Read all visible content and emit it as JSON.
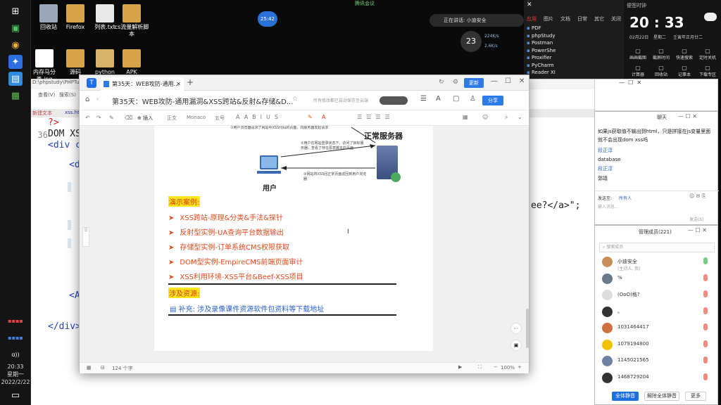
{
  "desktop": {
    "icons": [
      {
        "label": "回收站",
        "color": "#9aa6b8"
      },
      {
        "label": "Firefox",
        "color": "#d8a44a"
      },
      {
        "label": "列表.txt",
        "color": "#e8e8e8"
      },
      {
        "label": "cs流量解析脚本",
        "color": "#d8a44a"
      },
      {
        "label": "内存马分类.jpg",
        "color": "#ffffff"
      },
      {
        "label": "源码",
        "color": "#d8a44a"
      },
      {
        "label": "python",
        "color": "#d8b46a"
      },
      {
        "label": "APK",
        "color": "#d8a44a"
      }
    ],
    "meeting_label": "腾讯会议",
    "recording_time": "25:42",
    "speaking": "正在讲话: 小迪安全",
    "net_badge": "23",
    "net_up": "224K/s",
    "net_down": "2.6K/s"
  },
  "taskbar": {
    "time": "20:33",
    "weekday": "星期一",
    "date": "2022/2/22",
    "tray_text": "ɑ))"
  },
  "editor": {
    "path": "D:\\phpstudy\\PHPTutor",
    "menu_view": "查看(V)",
    "menu_search": "搜索(S)",
    "tabs": [
      "新建文本",
      "xss.html"
    ],
    "lines": [
      {
        "num": "",
        "text": "?>"
      },
      {
        "num": "36",
        "text": "DOM XSS"
      },
      {
        "num": "",
        "text": "<div c"
      },
      {
        "num": "",
        "text": "<d"
      },
      {
        "num": "",
        "text": "<A"
      },
      {
        "num": "",
        "text": "</div>"
      }
    ],
    "trailing_code": "ee?</a>\";"
  },
  "window": {
    "tab_title": "第35天：WEB攻防-通用...",
    "doc_title": "第35天：WEB攻防-通用漏洞&XSS跨站&反射&存储&D...",
    "save_hint": "所有修改都已自动保存至云端",
    "update_label": "更新",
    "share_label": "分享",
    "toolbar": [
      "插入",
      "正文",
      "Monaco",
      "五号"
    ],
    "word_count": "124 个字",
    "zoom": "100%"
  },
  "document": {
    "server_label": "正常服务器",
    "user_label": "用户",
    "note1": "①用户浏览器请求了网站中XSS代码的页面，向服务器发起请求",
    "note2": "②用户在网站登录状态下，访问了目标服务器，查看了存在恶意脚本的页面",
    "note3": "③网站将XSS回正常页面返回到用户浏览器",
    "section1": "演示案例:",
    "bullets": [
      "XSS跨站-原理&分类&手法&探针",
      "反射型实例-UA查询平台数据输出",
      "存储型实例-订单系统CMS权限获取",
      "DOM型实例-EmpireCMS前端页面审计",
      "XSS利用环境-XSS平台&Beef-XSS项目"
    ],
    "section2": "涉及资源:",
    "resource": "补充: 涉及录像课件资源软件包资料等下载地址"
  },
  "notify_panel": {
    "tabs": [
      "应用",
      "图片",
      "文档",
      "日常",
      "其它",
      "关闭"
    ],
    "apps": [
      "PDF",
      "phpStudy",
      "Postman",
      "PowerShe",
      "Proxifier",
      "PyCharm",
      "Reader XI"
    ]
  },
  "clock_panel": {
    "title": "便签时钟",
    "time": "20 : 33",
    "date": "02月22日",
    "weekday": "星期二",
    "lunar": "壬寅年正月廿二",
    "buttons": [
      "画画截图",
      "截屏时间",
      "快速搜索",
      "定时关机",
      "计算器",
      "回收站",
      "记事本",
      "下载专区"
    ]
  },
  "chat": {
    "title": "聊天",
    "messages": [
      "如果js获取值不输出到html，只是拼接在js变量里面就不会出现dom xss吗",
      "段正淳",
      "database",
      "段正淳",
      "郭靖"
    ],
    "send_to_label": "发送至:",
    "send_to_value": "所有人",
    "input_placeholder": "输入消息...",
    "send_label": "发送(S)"
  },
  "members": {
    "title": "管理成员(221)",
    "search_placeholder": "搜索成员",
    "list": [
      {
        "name": "小迪安全",
        "sub": "(主持人, 我)",
        "color": "#c88f5a"
      },
      {
        "name": "%",
        "sub": "",
        "color": "#6a7a8a"
      },
      {
        "name": "(OoO)格?",
        "sub": "",
        "color": "#dddddd"
      },
      {
        "name": "。",
        "sub": "",
        "color": "#333333"
      },
      {
        "name": "1031464417",
        "sub": "",
        "color": "#d07040"
      },
      {
        "name": "1079194800",
        "sub": "",
        "color": "#f2c200"
      },
      {
        "name": "1145021565",
        "sub": "",
        "color": "#7080a0"
      },
      {
        "name": "1468729204",
        "sub": "",
        "color": "#333333"
      }
    ],
    "mute_all": "全体静音",
    "unmute_all": "解除全体静音",
    "more": "更多"
  }
}
